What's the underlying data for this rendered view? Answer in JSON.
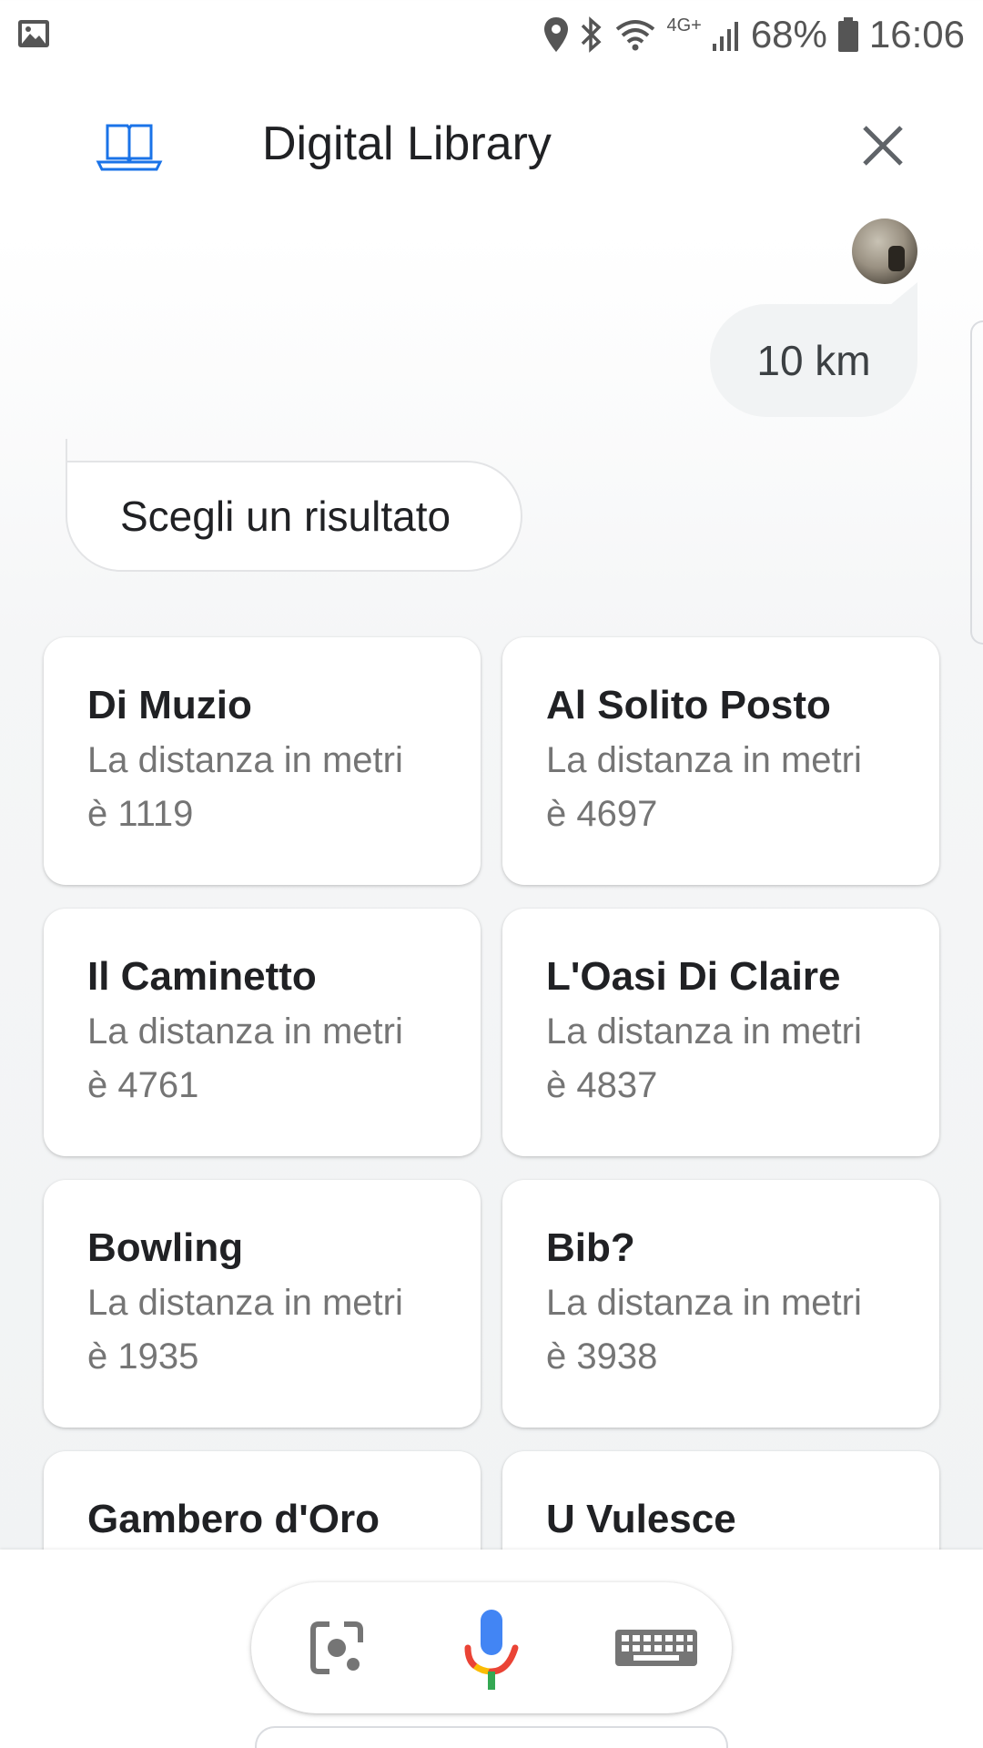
{
  "status_bar": {
    "battery": "68%",
    "time": "16:06",
    "network": "4G+",
    "icons": [
      "gallery-icon",
      "location-icon",
      "bluetooth-icon",
      "wifi-icon",
      "signal-icon",
      "battery-icon"
    ]
  },
  "header": {
    "title": "Digital Library",
    "logo_icon": "book-icon",
    "close_icon": "close-icon",
    "accent_color": "#1a73e8"
  },
  "chat": {
    "user_message": "10 km",
    "assistant_message": "Scegli un risultato"
  },
  "results": [
    {
      "title": "Di Muzio",
      "line1": "La distanza in metri",
      "line2": "è 1119"
    },
    {
      "title": "Al Solito Posto",
      "line1": "La distanza in metri",
      "line2": "è 4697"
    },
    {
      "title": "Il Caminetto",
      "line1": "La distanza in metri",
      "line2": "è 4761"
    },
    {
      "title": "L'Oasi Di Claire",
      "line1": "La distanza in metri",
      "line2": "è 4837"
    },
    {
      "title": "Bowling",
      "line1": "La distanza in metri",
      "line2": "è 1935"
    },
    {
      "title": "Bib?",
      "line1": "La distanza in metri",
      "line2": "è 3938"
    },
    {
      "title": "Gambero d'Oro",
      "line1": "",
      "line2": ""
    },
    {
      "title": "U Vulesce",
      "line1": "",
      "line2": ""
    }
  ],
  "input_bar": {
    "icons": [
      "lens-icon",
      "mic-icon",
      "keyboard-icon"
    ],
    "mic_colors": [
      "#4285f4",
      "#ea4335",
      "#fbbc04",
      "#34a853"
    ]
  }
}
